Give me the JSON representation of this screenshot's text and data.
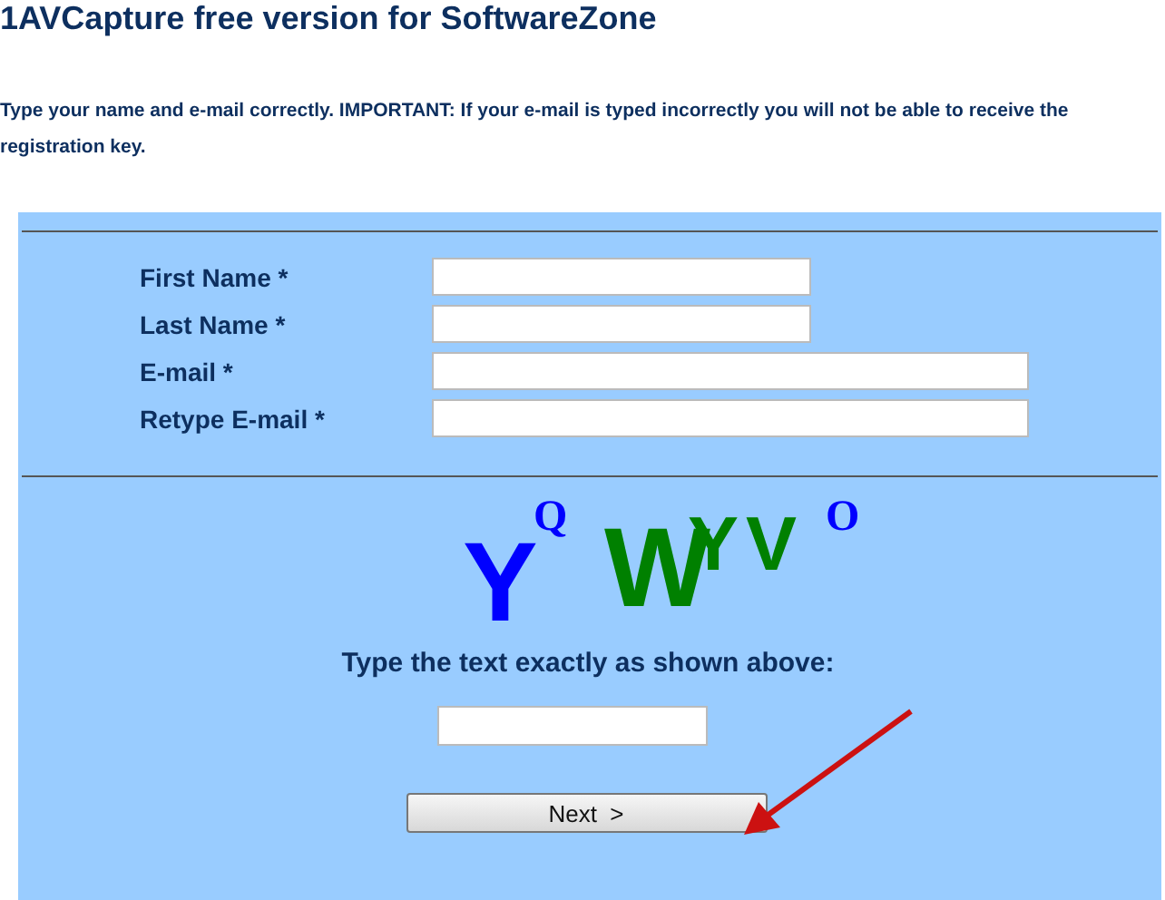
{
  "title": "1AVCapture free version for SoftwareZone",
  "intro": "Type your name and e-mail correctly. IMPORTANT: If your e-mail is typed incorrectly you will not be able to receive the registration key.",
  "fields": [
    {
      "label": "First Name *",
      "kind": "short"
    },
    {
      "label": "Last Name *",
      "kind": "short"
    },
    {
      "label": "E-mail *",
      "kind": "long"
    },
    {
      "label": "Retype E-mail *",
      "kind": "long"
    }
  ],
  "captcha": [
    {
      "text": "Y",
      "kind": "large",
      "color": "#0000ff"
    },
    {
      "text": "Q",
      "kind": "small",
      "color": "#0000ff"
    },
    {
      "text": "W",
      "kind": "large",
      "color": "#008000"
    },
    {
      "text": "Y",
      "kind": "medium",
      "color": "#008000"
    },
    {
      "text": "V",
      "kind": "medium",
      "color": "#008000"
    },
    {
      "text": "O",
      "kind": "small",
      "color": "#0000ff"
    }
  ],
  "captcha_prompt": "Type the text exactly as shown above:",
  "next_button": "Next  >"
}
